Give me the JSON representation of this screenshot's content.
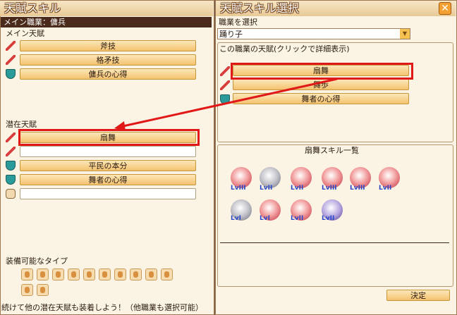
{
  "left_window": {
    "title": "天賦スキル",
    "main_job_label": "メイン職業：",
    "main_job_value": "傭兵",
    "main_talent_header": "メイン天賦",
    "main_talents": [
      "斧技",
      "格矛技",
      "傭兵の心得"
    ],
    "latent_header": "潜在天賦",
    "latent_talents": [
      "扇舞",
      "",
      "平民の本分",
      "舞者の心得",
      ""
    ],
    "equip_header": "装備可能なタイプ",
    "footer_text": "続けて他の潜在天賦も装着しよう！（他職業も選択可能）"
  },
  "right_window": {
    "title": "天賦スキル選択",
    "close_icon": "close-icon",
    "select_job_label": "職業を選択",
    "job_select_value": "踊り子",
    "job_talents_header": "この職業の天賦(クリックで詳細表示)",
    "job_talents": [
      "扇舞",
      "舞歩",
      "舞者の心得"
    ],
    "skill_list_header": "扇舞スキル一覧",
    "skill_levels_row1": [
      "LvIII",
      "LvII",
      "LvII",
      "LvIII",
      "LvIII",
      "LvII"
    ],
    "skill_levels_row2": [
      "LvI",
      "LvI",
      "LvII",
      "LvII"
    ],
    "confirm_button": "決定"
  },
  "colors": {
    "highlight": "#e01818",
    "button": "#f4c270",
    "dark_bar": "#4a2a1a"
  }
}
